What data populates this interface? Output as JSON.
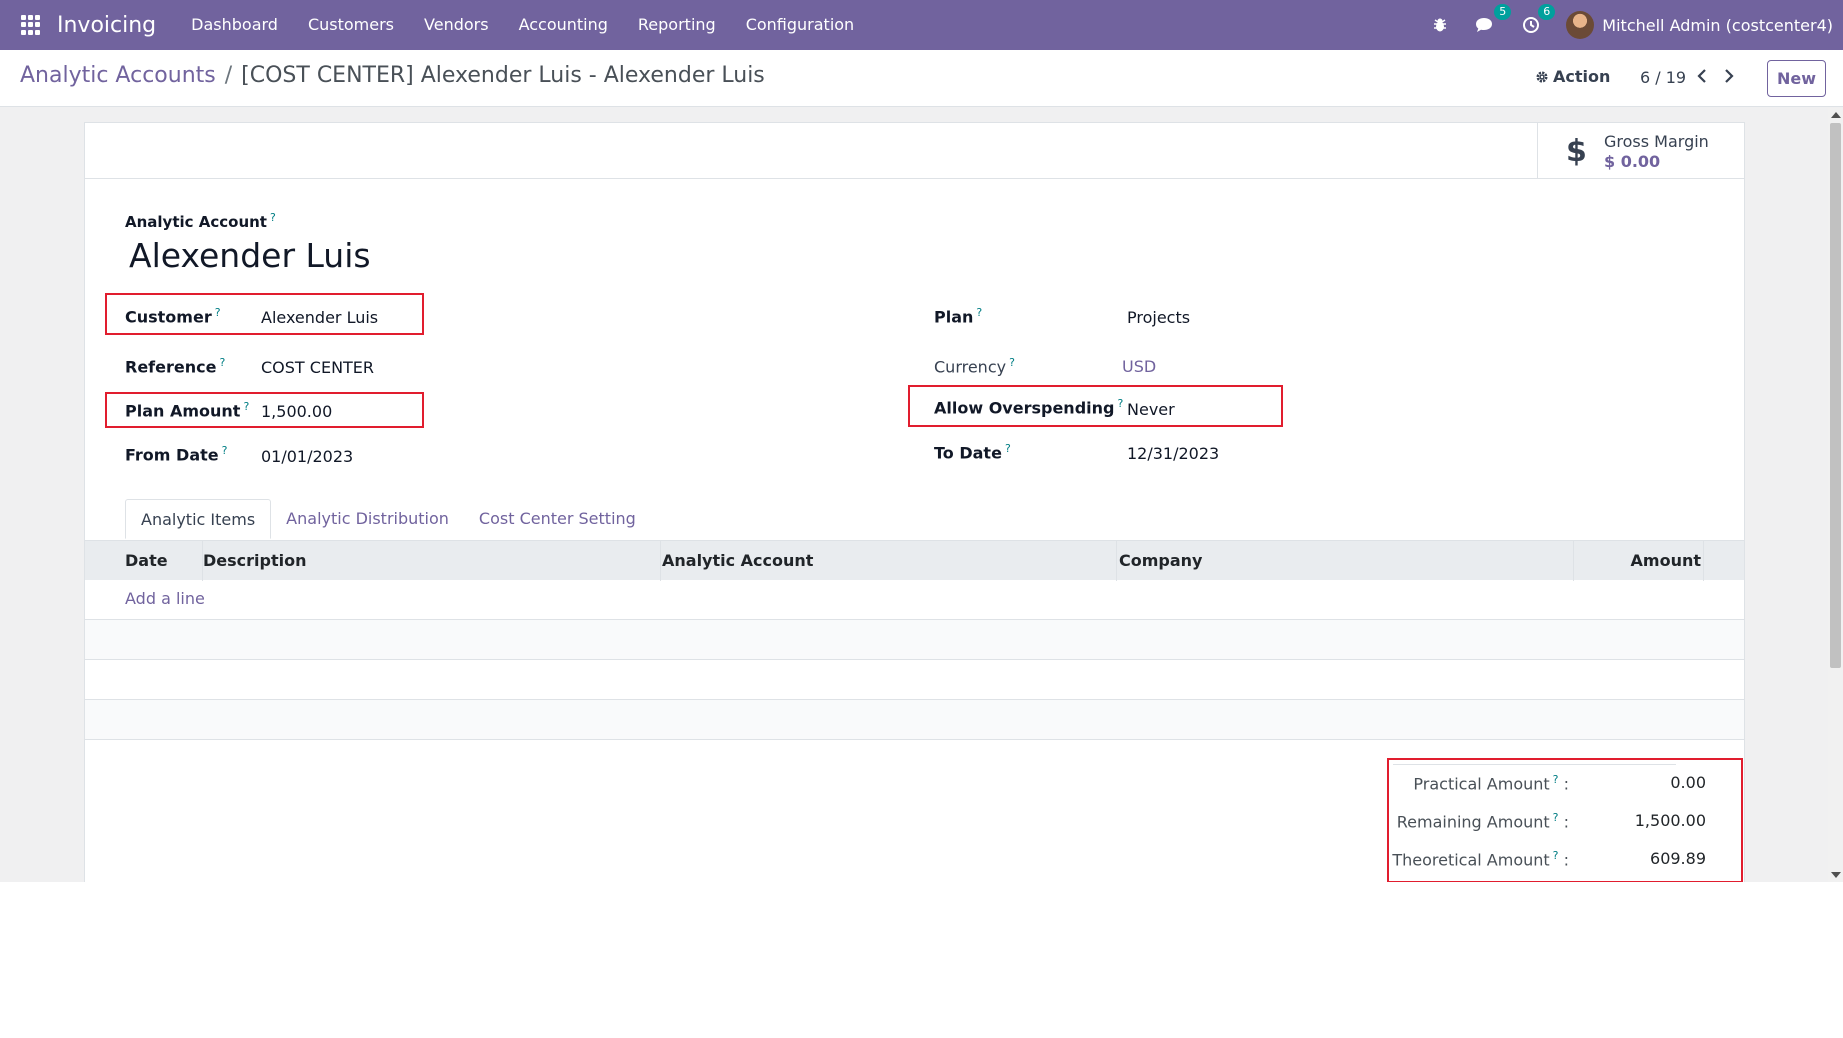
{
  "navbar": {
    "app_name": "Invoicing",
    "menu": [
      "Dashboard",
      "Customers",
      "Vendors",
      "Accounting",
      "Reporting",
      "Configuration"
    ],
    "messages_count": "5",
    "activities_count": "6",
    "user": "Mitchell Admin (costcenter4)",
    "background_color": "#71639e"
  },
  "control_panel": {
    "breadcrumb_parent": "Analytic Accounts",
    "breadcrumb_separator": "/",
    "breadcrumb_current": "[COST CENTER] Alexender Luis - Alexender Luis",
    "action_label": "Action",
    "pager": "6 / 19",
    "new_label": "New"
  },
  "stat_button": {
    "label": "Gross Margin",
    "value": "$ 0.00"
  },
  "form": {
    "title_label": "Analytic Account",
    "title": "Alexender Luis",
    "help_mark": "?",
    "fields_left": [
      {
        "label": "Customer",
        "value": "Alexender Luis"
      },
      {
        "label": "Reference",
        "value": "COST CENTER"
      },
      {
        "label": "Plan Amount",
        "value": "1,500.00"
      },
      {
        "label": "From Date",
        "value": "01/01/2023"
      }
    ],
    "fields_right": [
      {
        "label": "Plan",
        "value": "Projects"
      },
      {
        "label": "Currency",
        "value": "USD"
      },
      {
        "label": "Allow Overspending",
        "value": "Never"
      },
      {
        "label": "To Date",
        "value": "12/31/2023"
      }
    ]
  },
  "tabs": [
    "Analytic Items",
    "Analytic Distribution",
    "Cost Center Setting"
  ],
  "table": {
    "columns": [
      "Date",
      "Description",
      "Analytic Account",
      "Company",
      "Amount"
    ],
    "add_line": "Add a line"
  },
  "totals": [
    {
      "label": "Practical Amount",
      "value": "0.00"
    },
    {
      "label": "Remaining Amount",
      "value": "1,500.00"
    },
    {
      "label": "Theoretical Amount",
      "value": "609.89"
    }
  ],
  "colors": {
    "accent": "#71639e",
    "highlight": "#e11d2e",
    "help": "#017e84"
  }
}
